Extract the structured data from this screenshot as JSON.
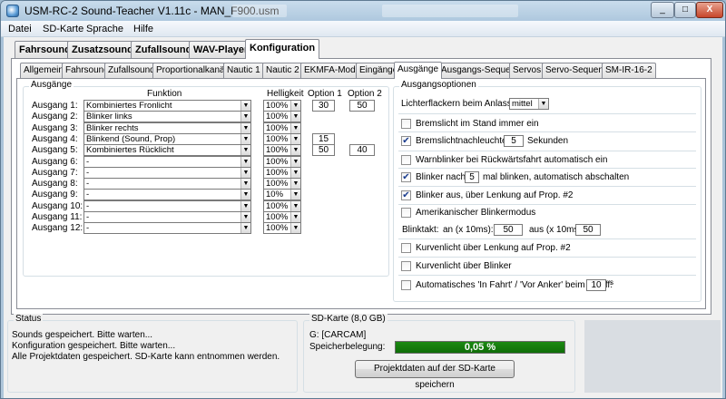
{
  "window": {
    "title": "USM-RC-2 Sound-Teacher V1.11c - MAN_F900.usm",
    "controls": [
      "_",
      "□",
      "X"
    ]
  },
  "menu": [
    "Datei",
    "SD-Karte",
    "Sprache",
    "Hilfe"
  ],
  "main_tabs": [
    "Fahrsound",
    "Zusatzsounds",
    "Zufallsounds",
    "WAV-Player",
    "Konfiguration"
  ],
  "main_tab_active": "Konfiguration",
  "sub_tabs": [
    "Allgemein",
    "Fahrsound",
    "Zufallsound",
    "Proportionalkanäle",
    "Nautic 1",
    "Nautic 2",
    "EKMFA-Modus",
    "Eingänge",
    "Ausgänge",
    "Ausgangs-Sequenz",
    "Servos",
    "Servo-Sequenz",
    "SM-IR-16-2"
  ],
  "sub_tab_active": "Ausgänge",
  "outputs": {
    "group_title": "Ausgänge",
    "headers": {
      "function": "Funktion",
      "brightness": "Helligkeit",
      "option1": "Option 1",
      "option2": "Option 2"
    },
    "rows": [
      {
        "label": "Ausgang 1:",
        "function": "Kombiniertes Fronlicht",
        "brightness": "100%",
        "opt1": "30",
        "opt2": "50"
      },
      {
        "label": "Ausgang 2:",
        "function": "Blinker links",
        "brightness": "100%",
        "opt1": "",
        "opt2": ""
      },
      {
        "label": "Ausgang 3:",
        "function": "Blinker rechts",
        "brightness": "100%",
        "opt1": "",
        "opt2": ""
      },
      {
        "label": "Ausgang 4:",
        "function": "Blinkend (Sound, Prop)",
        "brightness": "100%",
        "opt1": "15",
        "opt2": ""
      },
      {
        "label": "Ausgang 5:",
        "function": "Kombiniertes Rücklicht",
        "brightness": "100%",
        "opt1": "50",
        "opt2": "40"
      },
      {
        "label": "Ausgang 6:",
        "function": "-",
        "brightness": "100%",
        "opt1": "",
        "opt2": ""
      },
      {
        "label": "Ausgang 7:",
        "function": "-",
        "brightness": "100%",
        "opt1": "",
        "opt2": ""
      },
      {
        "label": "Ausgang 8:",
        "function": "-",
        "brightness": "100%",
        "opt1": "",
        "opt2": ""
      },
      {
        "label": "Ausgang 9:",
        "function": "-",
        "brightness": "10%",
        "opt1": "",
        "opt2": ""
      },
      {
        "label": "Ausgang 10:",
        "function": "-",
        "brightness": "100%",
        "opt1": "",
        "opt2": ""
      },
      {
        "label": "Ausgang 11:",
        "function": "-",
        "brightness": "100%",
        "opt1": "",
        "opt2": ""
      },
      {
        "label": "Ausgang 12:",
        "function": "-",
        "brightness": "100%",
        "opt1": "",
        "opt2": ""
      }
    ]
  },
  "options": {
    "group_title": "Ausgangsoptionen",
    "flicker_label": "Lichterflackern beim Anlassen:",
    "flicker_value": "mittel",
    "brake_standing": {
      "label": "Bremslicht im Stand immer ein",
      "checked": false
    },
    "brake_afterglow": {
      "label": "Bremslichtnachleuchten:",
      "checked": true,
      "value": "5",
      "unit": "Sekunden"
    },
    "hazard_reverse": {
      "label": "Warnblinker bei Rückwärtsfahrt automatisch ein",
      "checked": false
    },
    "blinker_after": {
      "label_pre": "Blinker nach",
      "value": "5",
      "label_post": "mal blinken, automatisch abschalten",
      "checked": true
    },
    "blinker_off_steering": {
      "label": "Blinker aus, über Lenkung auf Prop. #2",
      "checked": true
    },
    "american_mode": {
      "label": "Amerikanischer Blinkermodus",
      "checked": false
    },
    "blink_rate": {
      "label": "Blinktakt:",
      "on_label": "an (x 10ms):",
      "on_value": "50",
      "off_label": "aus (x 10ms):",
      "off_value": "50"
    },
    "curve_steering": {
      "label": "Kurvenlicht über Lenkung auf Prop. #2",
      "checked": false
    },
    "curve_blinker": {
      "label": "Kurvenlicht über Blinker",
      "checked": false
    },
    "ship_auto": {
      "label": "Automatisches 'In Fahrt' / 'Vor Anker' beim Schiff:",
      "checked": false,
      "value": "10",
      "unit": "s"
    }
  },
  "status": {
    "title": "Status",
    "lines": [
      "Sounds gespeichert. Bitte warten...",
      "Konfiguration gespeichert. Bitte warten...",
      "Alle Projektdaten gespeichert. SD-Karte kann entnommen werden."
    ]
  },
  "sdcard": {
    "title": "SD-Karte (8,0 GB)",
    "drive": "G: [CARCAM]",
    "usage_label": "Speicherbelegung:",
    "usage_text": "0,05 %",
    "usage_fraction": 1.0,
    "save_button": "Projektdaten auf der SD-Karte speichern",
    "bar_color": "#1c8a12"
  }
}
